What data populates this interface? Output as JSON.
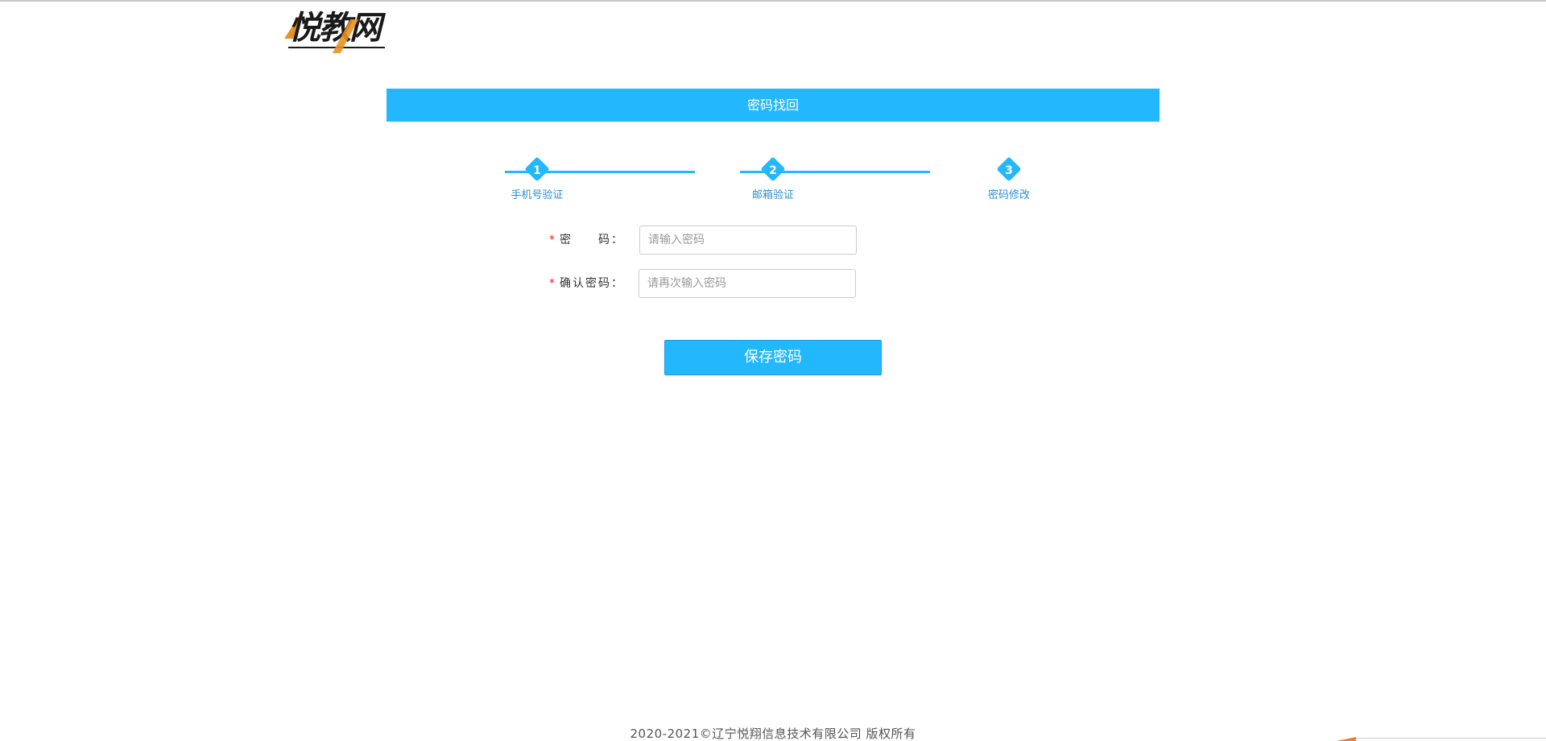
{
  "logo": {
    "text": "悦教网",
    "accent_color": "#e8921e"
  },
  "header": {
    "title": "密码找回",
    "color": "#23b7fd"
  },
  "steps": [
    {
      "number": "1",
      "label": "手机号验证"
    },
    {
      "number": "2",
      "label": "邮箱验证"
    },
    {
      "number": "3",
      "label": "密码修改"
    }
  ],
  "form": {
    "password": {
      "required_mark": "*",
      "label": "密　　码：",
      "placeholder": "请输入密码",
      "value": ""
    },
    "confirm_password": {
      "required_mark": "*",
      "label": "确认密码：",
      "placeholder": "请再次输入密码",
      "value": ""
    },
    "save_label": "保存密码"
  },
  "footer": {
    "copyright": "2020-2021©辽宁悦翔信息技术有限公司 版权所有"
  }
}
